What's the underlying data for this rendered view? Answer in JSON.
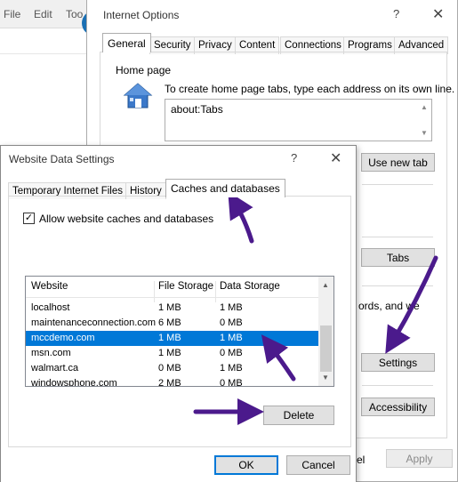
{
  "browser_menu": {
    "file": "File",
    "edit": "Edit",
    "tools_partial": "Too"
  },
  "internet_options": {
    "title": "Internet Options",
    "help": "?",
    "close": "✕",
    "tabs": [
      "General",
      "Security",
      "Privacy",
      "Content",
      "Connections",
      "Programs",
      "Advanced"
    ],
    "home_page": {
      "group_title": "Home page",
      "instruction": "To create home page tabs, type each address on its own line.",
      "value": "about:Tabs"
    },
    "use_new_tab": "Use new tab",
    "tabs_button": "Tabs",
    "partial_text": "ords, and we",
    "settings_button": "Settings",
    "accessibility_button": "Accessibility",
    "cancel_partial": "el",
    "apply_button": "Apply"
  },
  "website_data": {
    "title": "Website Data Settings",
    "help": "?",
    "close": "✕",
    "tabs": [
      "Temporary Internet Files",
      "History",
      "Caches and databases"
    ],
    "allow_caches_label": "Allow website caches and databases",
    "allow_caches_checked": true,
    "columns": [
      "Website",
      "File Storage",
      "Data Storage"
    ],
    "rows": [
      {
        "website": "localhost",
        "file": "1 MB",
        "data": "1 MB"
      },
      {
        "website": "maintenanceconnection.com",
        "file": "6 MB",
        "data": "0 MB"
      },
      {
        "website": "mccdemo.com",
        "file": "1 MB",
        "data": "1 MB",
        "selected": true
      },
      {
        "website": "msn.com",
        "file": "1 MB",
        "data": "0 MB"
      },
      {
        "website": "walmart.ca",
        "file": "0 MB",
        "data": "1 MB"
      },
      {
        "website": "windowsphone.com",
        "file": "2 MB",
        "data": "0 MB"
      }
    ],
    "delete_button": "Delete",
    "ok_button": "OK",
    "cancel_button": "Cancel"
  },
  "colors": {
    "selection": "#0078d7",
    "annotation_arrow": "#4b1a8c",
    "browser_blue": "#1a6fb3"
  }
}
